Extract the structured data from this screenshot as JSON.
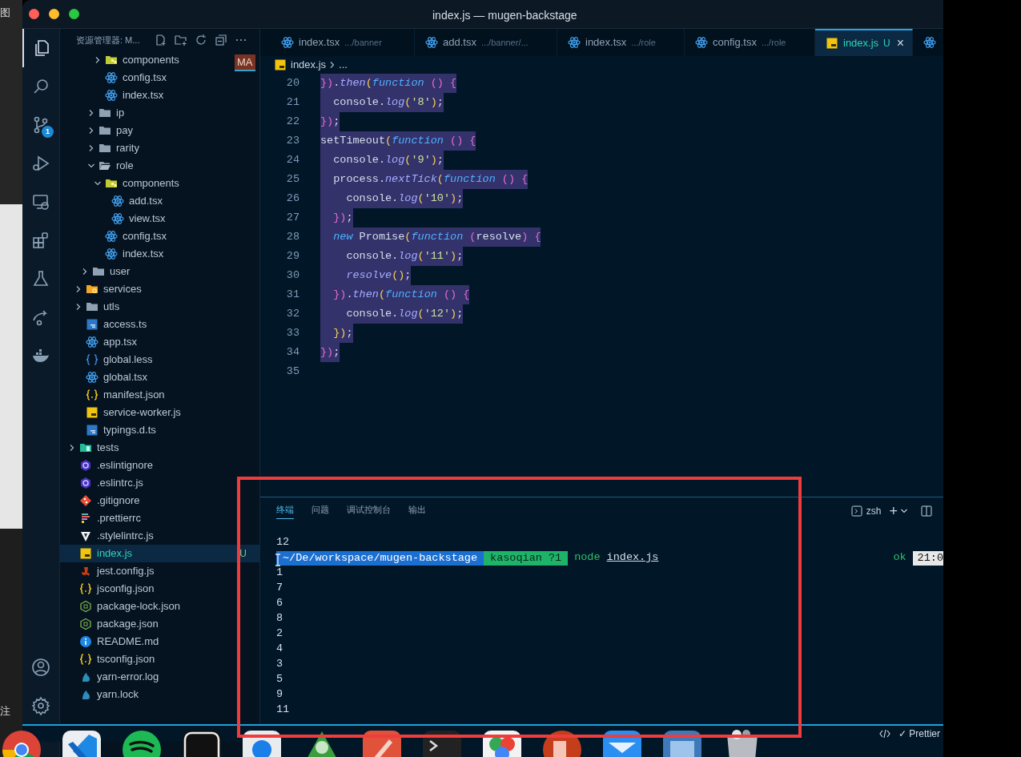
{
  "background_app": {
    "top_text": "图",
    "bottom_text": "注"
  },
  "window": {
    "title": "index.js — mugen-backstage"
  },
  "activity_bar": {
    "scm_badge": "1"
  },
  "sidebar": {
    "title": "资源管理器: M...",
    "tree": [
      {
        "children": [
          {
            "children": [
              {
                "children": [
                  {
                    "children": [
                      {
                        "label": "components",
                        "kind": "folder-components",
                        "expanded": false,
                        "selected": false
                      },
                      {
                        "label": "config.tsx",
                        "kind": "react",
                        "selected": false
                      },
                      {
                        "label": "index.tsx",
                        "kind": "react",
                        "selected": false
                      }
                    ]
                  },
                  {
                    "label": "ip",
                    "kind": "folder",
                    "expanded": false,
                    "selected": false
                  },
                  {
                    "label": "pay",
                    "kind": "folder",
                    "expanded": false,
                    "selected": false
                  },
                  {
                    "label": "rarity",
                    "kind": "folder",
                    "expanded": false,
                    "selected": false
                  },
                  {
                    "label": "role",
                    "kind": "folder",
                    "expanded": true,
                    "selected": false,
                    "children": [
                      {
                        "label": "components",
                        "kind": "folder-components",
                        "expanded": true,
                        "selected": false,
                        "children": [
                          {
                            "label": "add.tsx",
                            "kind": "react",
                            "selected": false
                          },
                          {
                            "label": "view.tsx",
                            "kind": "react",
                            "selected": false
                          }
                        ]
                      },
                      {
                        "label": "config.tsx",
                        "kind": "react",
                        "selected": false
                      },
                      {
                        "label": "index.tsx",
                        "kind": "react",
                        "selected": false
                      }
                    ]
                  }
                ]
              },
              {
                "label": "user",
                "kind": "folder",
                "expanded": false,
                "selected": false
              }
            ]
          },
          {
            "label": "services",
            "kind": "folder-services",
            "expanded": false,
            "selected": false
          },
          {
            "label": "utls",
            "kind": "folder",
            "expanded": false,
            "selected": false
          },
          {
            "label": "access.ts",
            "kind": "ts",
            "selected": false
          },
          {
            "label": "app.tsx",
            "kind": "react",
            "selected": false
          },
          {
            "label": "global.less",
            "kind": "less",
            "selected": false
          },
          {
            "label": "global.tsx",
            "kind": "react",
            "selected": false
          },
          {
            "label": "manifest.json",
            "kind": "json",
            "selected": false
          },
          {
            "label": "service-worker.js",
            "kind": "js",
            "selected": false
          },
          {
            "label": "typings.d.ts",
            "kind": "ts",
            "selected": false
          }
        ]
      },
      {
        "label": "tests",
        "kind": "folder-tests",
        "expanded": false,
        "selected": false
      },
      {
        "label": ".eslintignore",
        "kind": "eslint",
        "selected": false
      },
      {
        "label": ".eslintrc.js",
        "kind": "eslint",
        "selected": false
      },
      {
        "label": ".gitignore",
        "kind": "git",
        "selected": false
      },
      {
        "label": ".prettierrc",
        "kind": "prettier",
        "selected": false
      },
      {
        "label": ".stylelintrc.js",
        "kind": "stylelint",
        "selected": false
      },
      {
        "label": "index.js",
        "kind": "js",
        "selected": true,
        "badge": "U"
      },
      {
        "label": "jest.config.js",
        "kind": "jest",
        "selected": false
      },
      {
        "label": "jsconfig.json",
        "kind": "json",
        "selected": false
      },
      {
        "label": "package-lock.json",
        "kind": "node",
        "selected": false
      },
      {
        "label": "package.json",
        "kind": "node",
        "selected": false
      },
      {
        "label": "README.md",
        "kind": "info",
        "selected": false
      },
      {
        "label": "tsconfig.json",
        "kind": "json",
        "selected": false
      },
      {
        "label": "yarn-error.log",
        "kind": "yarn",
        "selected": false
      },
      {
        "label": "yarn.lock",
        "kind": "yarn",
        "selected": false
      }
    ],
    "overlay_badge": "MA"
  },
  "tabs": [
    {
      "label": "index.tsx",
      "path": ".../banner",
      "kind": "react",
      "selected": false
    },
    {
      "label": "add.tsx",
      "path": ".../banner/...",
      "kind": "react",
      "selected": false
    },
    {
      "label": "index.tsx",
      "path": ".../role",
      "kind": "react",
      "selected": false
    },
    {
      "label": "config.tsx",
      "path": ".../role",
      "kind": "react",
      "selected": false
    },
    {
      "label": "index.js",
      "badge": "U",
      "kind": "js",
      "selected": true,
      "close": "×"
    },
    {
      "kind": "react",
      "selected": false
    }
  ],
  "breadcrumb": [
    {
      "label": "index.js",
      "kind": "js"
    },
    {
      "label": "..."
    }
  ],
  "code_lines": [
    {
      "number": "20",
      "selected": true,
      "tokens": [
        {
          "kind": "brace",
          "text": "})"
        },
        {
          "kind": "plain",
          "text": "."
        },
        {
          "kind": "method",
          "text": "then"
        },
        {
          "kind": "paren",
          "text": "("
        },
        {
          "kind": "kw",
          "text": "function"
        },
        {
          "kind": "brace",
          "text": " ()"
        },
        {
          "kind": "brace",
          "text": " {"
        }
      ]
    },
    {
      "number": "21",
      "selected": true,
      "tokens": [
        {
          "kind": "plain",
          "text": "  console."
        },
        {
          "kind": "method",
          "text": "log"
        },
        {
          "kind": "paren",
          "text": "("
        },
        {
          "kind": "string",
          "text": "'8'"
        },
        {
          "kind": "paren",
          "text": ")"
        },
        {
          "kind": "plain",
          "text": ";"
        }
      ]
    },
    {
      "number": "22",
      "selected": true,
      "tokens": [
        {
          "kind": "brace",
          "text": "})"
        },
        {
          "kind": "plain",
          "text": ";"
        }
      ]
    },
    {
      "number": "23",
      "selected": true,
      "tokens": [
        {
          "kind": "plain",
          "text": "setTimeout"
        },
        {
          "kind": "paren",
          "text": "("
        },
        {
          "kind": "kw",
          "text": "function"
        },
        {
          "kind": "brace",
          "text": " ()"
        },
        {
          "kind": "brace",
          "text": " {"
        }
      ]
    },
    {
      "number": "24",
      "selected": true,
      "tokens": [
        {
          "kind": "plain",
          "text": "  console."
        },
        {
          "kind": "method",
          "text": "log"
        },
        {
          "kind": "paren",
          "text": "("
        },
        {
          "kind": "string",
          "text": "'9'"
        },
        {
          "kind": "paren",
          "text": ")"
        },
        {
          "kind": "plain",
          "text": ";"
        }
      ]
    },
    {
      "number": "25",
      "selected": true,
      "tokens": [
        {
          "kind": "plain",
          "text": "  process."
        },
        {
          "kind": "method",
          "text": "nextTick"
        },
        {
          "kind": "paren",
          "text": "("
        },
        {
          "kind": "kw",
          "text": "function"
        },
        {
          "kind": "brace",
          "text": " ()"
        },
        {
          "kind": "brace",
          "text": " {"
        }
      ]
    },
    {
      "number": "26",
      "selected": true,
      "tokens": [
        {
          "kind": "plain",
          "text": "    console."
        },
        {
          "kind": "method",
          "text": "log"
        },
        {
          "kind": "paren",
          "text": "("
        },
        {
          "kind": "string",
          "text": "'10'"
        },
        {
          "kind": "paren",
          "text": ")"
        },
        {
          "kind": "plain",
          "text": ";"
        }
      ]
    },
    {
      "number": "27",
      "selected": true,
      "tokens": [
        {
          "kind": "brace",
          "text": "  })"
        },
        {
          "kind": "plain",
          "text": ";"
        }
      ]
    },
    {
      "number": "28",
      "selected": true,
      "tokens": [
        {
          "kind": "kw",
          "text": "  new"
        },
        {
          "kind": "plain",
          "text": " Promise"
        },
        {
          "kind": "paren",
          "text": "("
        },
        {
          "kind": "kw",
          "text": "function"
        },
        {
          "kind": "brace",
          "text": " ("
        },
        {
          "kind": "plain",
          "text": "resolve"
        },
        {
          "kind": "brace",
          "text": ")"
        },
        {
          "kind": "brace",
          "text": " {"
        }
      ]
    },
    {
      "number": "29",
      "selected": true,
      "tokens": [
        {
          "kind": "plain",
          "text": "    console."
        },
        {
          "kind": "method",
          "text": "log"
        },
        {
          "kind": "paren",
          "text": "("
        },
        {
          "kind": "string",
          "text": "'11'"
        },
        {
          "kind": "paren",
          "text": ")"
        },
        {
          "kind": "plain",
          "text": ";"
        }
      ]
    },
    {
      "number": "30",
      "selected": true,
      "tokens": [
        {
          "kind": "method",
          "text": "    resolve"
        },
        {
          "kind": "paren",
          "text": "()"
        },
        {
          "kind": "plain",
          "text": ";"
        }
      ]
    },
    {
      "number": "31",
      "selected": true,
      "tokens": [
        {
          "kind": "brace",
          "text": "  })"
        },
        {
          "kind": "plain",
          "text": "."
        },
        {
          "kind": "method",
          "text": "then"
        },
        {
          "kind": "paren",
          "text": "("
        },
        {
          "kind": "kw",
          "text": "function"
        },
        {
          "kind": "brace",
          "text": " ()"
        },
        {
          "kind": "brace",
          "text": " {"
        }
      ]
    },
    {
      "number": "32",
      "selected": true,
      "tokens": [
        {
          "kind": "plain",
          "text": "    console."
        },
        {
          "kind": "method",
          "text": "log"
        },
        {
          "kind": "paren",
          "text": "("
        },
        {
          "kind": "string",
          "text": "'12'"
        },
        {
          "kind": "paren",
          "text": ")"
        },
        {
          "kind": "plain",
          "text": ";"
        }
      ]
    },
    {
      "number": "33",
      "selected": true,
      "tokens": [
        {
          "kind": "paren",
          "text": "  })"
        },
        {
          "kind": "plain",
          "text": ";"
        }
      ]
    },
    {
      "number": "34",
      "selected": true,
      "tokens": [
        {
          "kind": "brace",
          "text": "})"
        },
        {
          "kind": "plain",
          "text": ";"
        }
      ]
    },
    {
      "number": "35"
    }
  ],
  "panel": {
    "tabs": [
      {
        "label": "终端",
        "selected": true
      },
      {
        "label": "问题",
        "selected": false
      },
      {
        "label": "调试控制台",
        "selected": false
      },
      {
        "label": "输出",
        "selected": false
      }
    ],
    "shell": "zsh",
    "new_terminal": "+",
    "terminal_lines": [
      {
        "kind": "output",
        "text": "12"
      },
      {
        "kind": "prompt",
        "path": "~/De/workspace/mugen-backstage",
        "branch": "kasoqian ?1",
        "command": "node",
        "argument": "index.js",
        "status": "ok",
        "time": "21:0"
      },
      {
        "kind": "output",
        "text": "1"
      },
      {
        "kind": "output",
        "text": "7"
      },
      {
        "kind": "output",
        "text": "6"
      },
      {
        "kind": "output",
        "text": "8"
      },
      {
        "kind": "output",
        "text": "2"
      },
      {
        "kind": "output",
        "text": "4"
      },
      {
        "kind": "output",
        "text": "3"
      },
      {
        "kind": "output",
        "text": "5"
      },
      {
        "kind": "output",
        "text": "9"
      },
      {
        "kind": "output",
        "text": "11"
      }
    ]
  },
  "status_bar": {
    "formatter": "✓ Prettier"
  }
}
